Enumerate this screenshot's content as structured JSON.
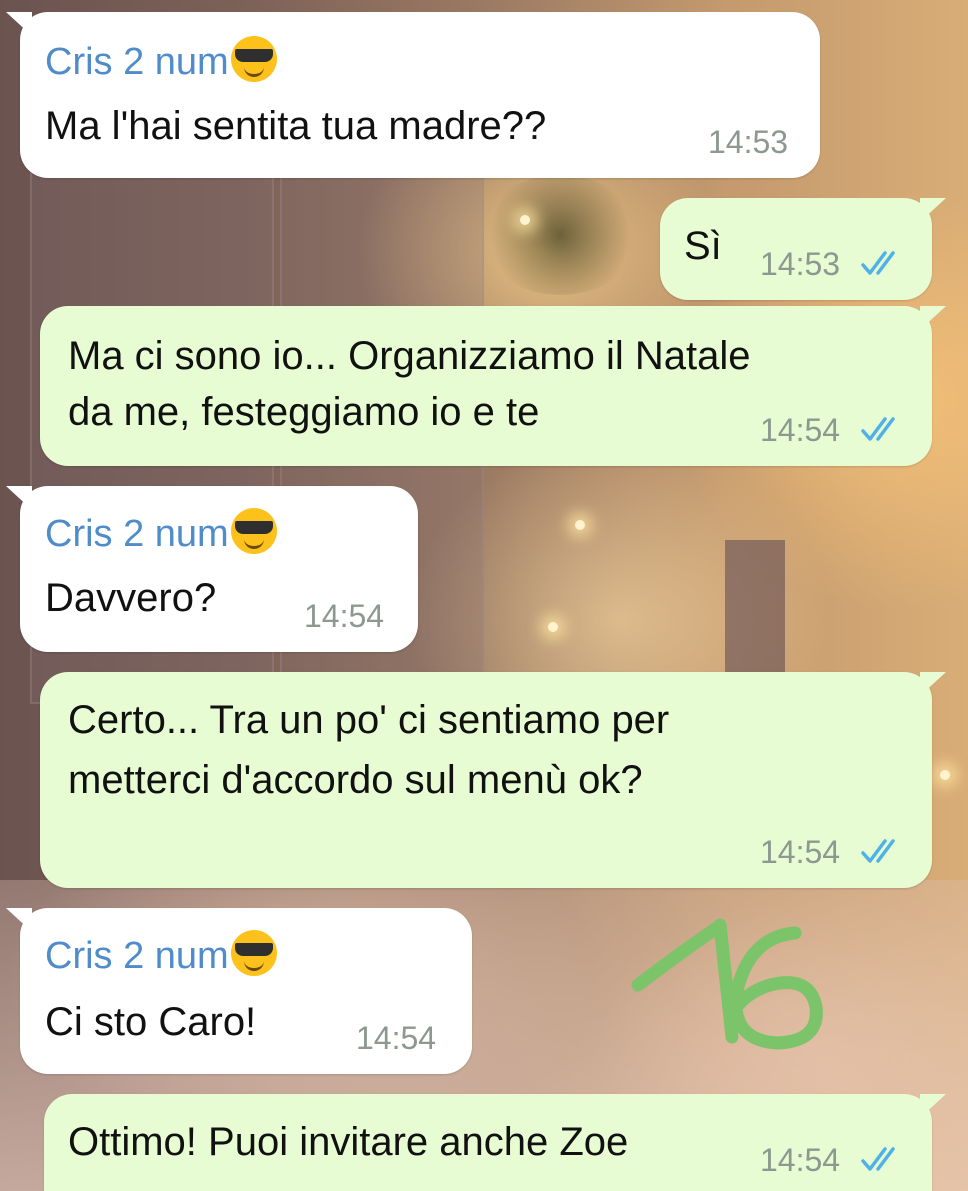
{
  "colors": {
    "incoming_bubble": "#ffffff",
    "outgoing_bubble": "#e7fcd3",
    "sender_name": "#4f8cc9",
    "read_ticks": "#4fb2e6",
    "sticker_number": "#7bc46a"
  },
  "messages": [
    {
      "direction": "in",
      "sender": "Cris 2 num",
      "sender_emoji": "smiling-face-with-sunglasses-icon",
      "text": "Ma l'hai sentita tua madre??",
      "time": "14:53"
    },
    {
      "direction": "out",
      "text": "Sì",
      "time": "14:53",
      "status": "read"
    },
    {
      "direction": "out",
      "lines": [
        "Ma ci sono io... Organizziamo il Natale",
        "da me, festeggiamo io e te"
      ],
      "time": "14:54",
      "status": "read"
    },
    {
      "direction": "in",
      "sender": "Cris 2 num",
      "sender_emoji": "smiling-face-with-sunglasses-icon",
      "text": "Davvero?",
      "time": "14:54"
    },
    {
      "direction": "out",
      "lines": [
        "Certo... Tra un po' ci sentiamo per",
        "metterci d'accordo sul menù ok?"
      ],
      "time": "14:54",
      "status": "read"
    },
    {
      "direction": "in",
      "sender": "Cris 2 num",
      "sender_emoji": "smiling-face-with-sunglasses-icon",
      "text": "Ci sto Caro!",
      "time": "14:54"
    },
    {
      "direction": "out",
      "text": "Ottimo! Puoi invitare anche Zoe",
      "time": "14:54",
      "status": "read"
    }
  ],
  "sticker": {
    "text": "16",
    "icon": "handwritten-number-sticker"
  }
}
